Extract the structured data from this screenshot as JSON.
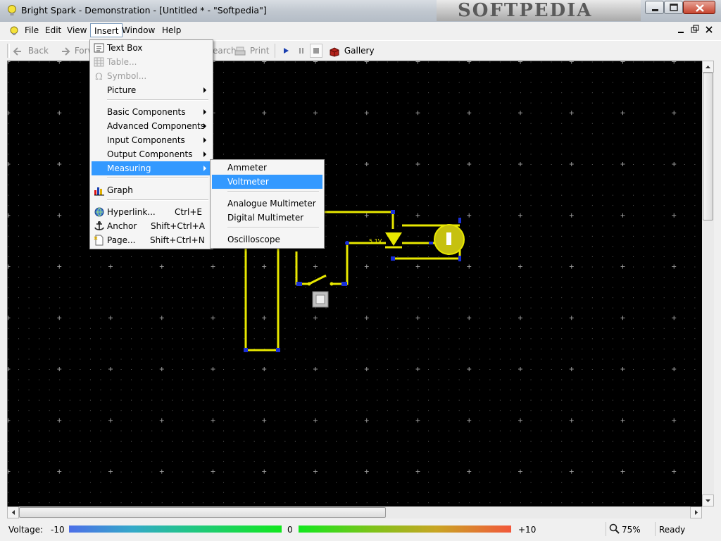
{
  "window": {
    "title": "Bright Spark - Demonstration - [Untitled * - \"Softpedia\"]",
    "watermark": "SOFTPEDIA"
  },
  "menubar": {
    "items": [
      "File",
      "Edit",
      "View",
      "Insert",
      "Window",
      "Help"
    ],
    "active": "Insert"
  },
  "toolbar": {
    "back": "Back",
    "forward": "Forw",
    "search": "earch",
    "print": "Print",
    "gallery": "Gallery"
  },
  "insert_menu": {
    "items": [
      {
        "label": "Text Box",
        "icon": "text-box-icon"
      },
      {
        "label": "Table...",
        "icon": "table-icon",
        "disabled": true
      },
      {
        "label": "Symbol...",
        "icon": "symbol-icon",
        "disabled": true
      },
      {
        "label": "Picture",
        "submenu": true
      },
      {
        "label": "Basic Components",
        "submenu": true
      },
      {
        "label": "Advanced Components",
        "submenu": true
      },
      {
        "label": "Input Components",
        "submenu": true
      },
      {
        "label": "Output Components",
        "submenu": true
      },
      {
        "label": "Measuring",
        "submenu": true,
        "highlighted": true
      },
      {
        "label": "Graph",
        "icon": "graph-icon"
      },
      {
        "label": "Hyperlink...",
        "shortcut": "Ctrl+E",
        "icon": "hyperlink-icon"
      },
      {
        "label": "Anchor",
        "shortcut": "Shift+Ctrl+A",
        "icon": "anchor-icon"
      },
      {
        "label": "Page...",
        "shortcut": "Shift+Ctrl+N",
        "icon": "page-icon"
      }
    ]
  },
  "measuring_menu": {
    "items": [
      {
        "label": "Ammeter"
      },
      {
        "label": "Voltmeter",
        "highlighted": true
      },
      {
        "label": "Analogue Multimeter"
      },
      {
        "label": "Digital Multimeter"
      },
      {
        "label": "Oscilloscope"
      }
    ]
  },
  "circuit": {
    "zener_label": "5.1V",
    "colors": {
      "wire": "#e8e800",
      "node": "#1a2fd8",
      "background": "#000000",
      "grid": "#9a9a9a"
    }
  },
  "statusbar": {
    "voltage_label": "Voltage:",
    "min": "-10",
    "zero": "0",
    "max": "+10",
    "zoom": "75%",
    "state": "Ready"
  }
}
